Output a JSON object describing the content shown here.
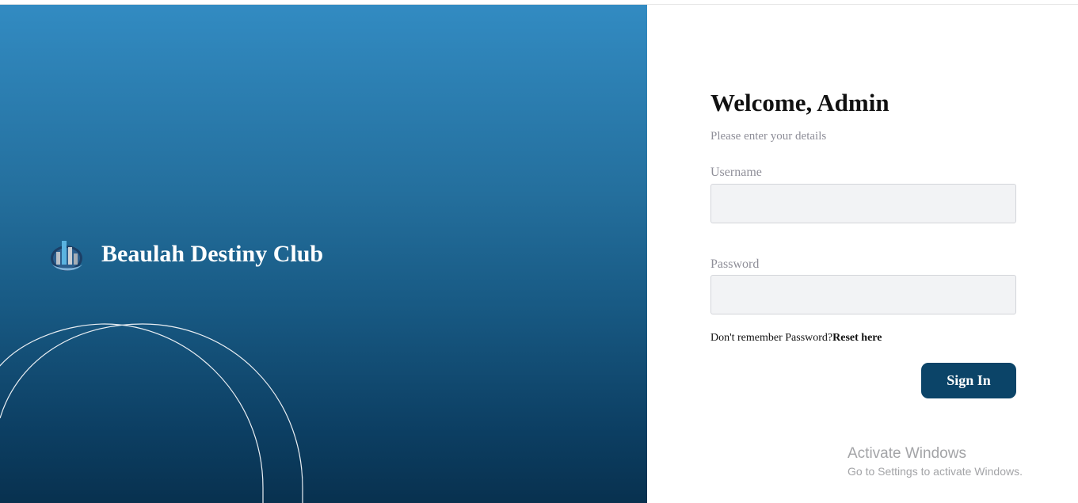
{
  "brand": {
    "name": "Beaulah Destiny Club",
    "logo_icon": "bar-chart-globe-icon"
  },
  "form": {
    "title": "Welcome, Admin",
    "subtitle": "Please enter your details",
    "username_label": "Username",
    "username_value": "",
    "password_label": "Password",
    "password_value": "",
    "forgot_text": "Don't remember Password?",
    "reset_link": "Reset here",
    "signin_label": "Sign In"
  },
  "watermark": {
    "title": "Activate Windows",
    "subtitle": "Go to Settings to activate Windows."
  },
  "colors": {
    "gradient_top": "#328bc2",
    "gradient_bottom": "#08314f",
    "button_bg": "#0b4468",
    "input_bg": "#f2f3f5",
    "label_gray": "#8e8e98"
  }
}
